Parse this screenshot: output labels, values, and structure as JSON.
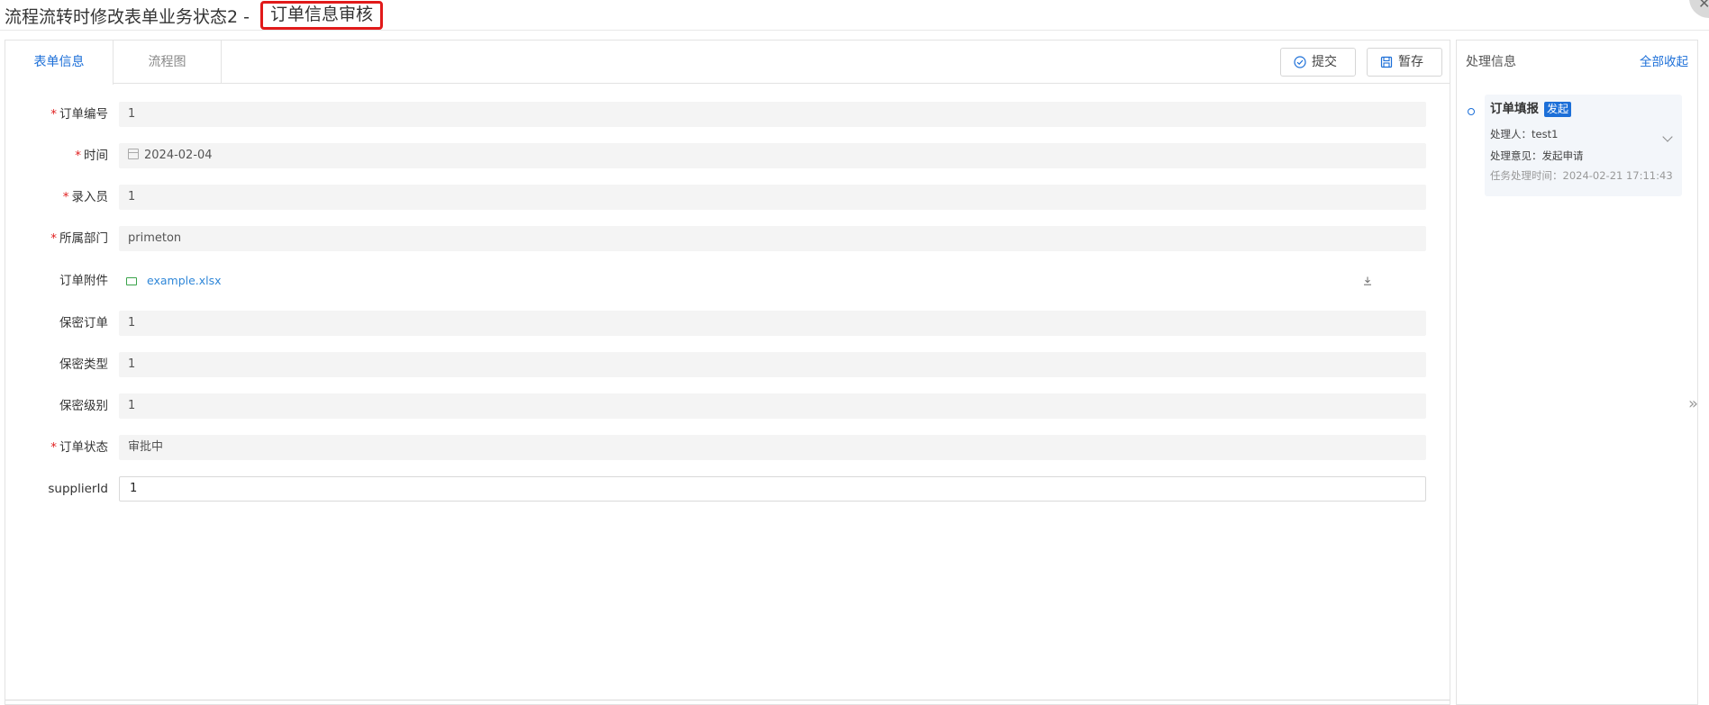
{
  "window": {
    "title_prefix": "流程流转时修改表单业务状态2 - ",
    "title_highlight": "订单信息审核",
    "close_symbol": "✕"
  },
  "tabs": [
    {
      "label": "表单信息",
      "active": true
    },
    {
      "label": "流程图",
      "active": false
    }
  ],
  "toolbar": {
    "submit_label": "提交",
    "save_label": "暂存"
  },
  "form": {
    "fields": [
      {
        "label": "订单编号",
        "required": true,
        "value": "1"
      },
      {
        "label": "时间",
        "required": true,
        "value": "2024-02-04",
        "type": "date"
      },
      {
        "label": "录入员",
        "required": true,
        "value": "1"
      },
      {
        "label": "所属部门",
        "required": true,
        "value": "primeton"
      },
      {
        "label": "订单附件",
        "required": false,
        "file": "example.xlsx",
        "type": "file"
      },
      {
        "label": "保密订单",
        "required": false,
        "value": "1"
      },
      {
        "label": "保密类型",
        "required": false,
        "value": "1"
      },
      {
        "label": "保密级别",
        "required": false,
        "value": "1"
      },
      {
        "label": "订单状态",
        "required": true,
        "value": "审批中"
      },
      {
        "label": "supplierId",
        "required": false,
        "value": "1",
        "editable": true
      }
    ],
    "required_mark": "*"
  },
  "side": {
    "title": "处理信息",
    "collapse_all": "全部收起",
    "timeline": [
      {
        "name": "订单填报",
        "tag": "发起",
        "handler": "处理人：test1",
        "opinion": "处理意见：发起申请",
        "time": "任务处理时间：2024-02-21 17:11:43"
      }
    ]
  },
  "expand_symbol": "»",
  "colors": {
    "accent": "#1c6fd8",
    "required": "#e02020",
    "highlight_border": "#e11a1a",
    "file_link": "#2f87d8"
  }
}
